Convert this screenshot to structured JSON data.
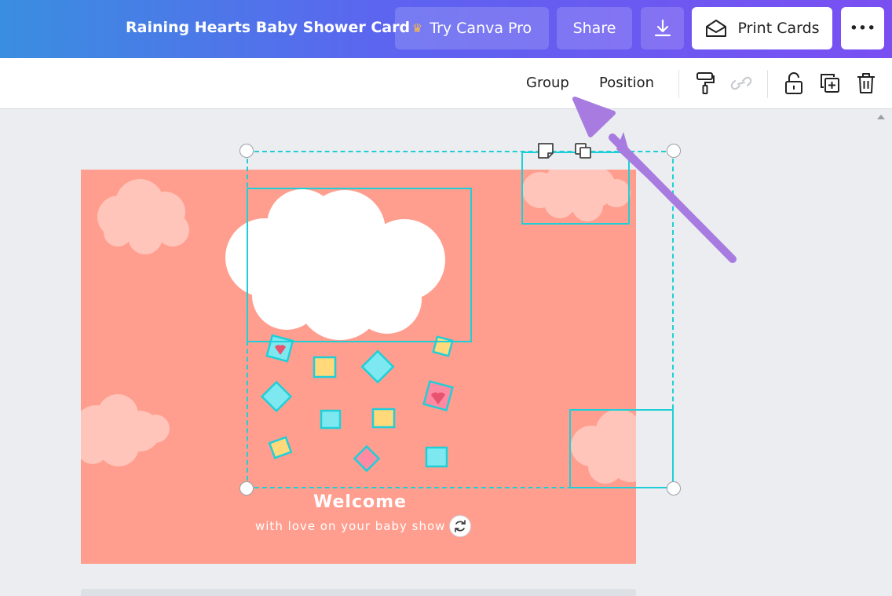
{
  "header": {
    "title": "Raining Hearts Baby Shower Card",
    "try_pro_label": "Try Canva Pro",
    "share_label": "Share",
    "print_label": "Print Cards",
    "more_label": "•••"
  },
  "toolbar": {
    "group_label": "Group",
    "position_label": "Position"
  },
  "card": {
    "welcome": "Welcome",
    "subline": "with love on your baby show"
  },
  "colors": {
    "accent": "#1fcfd8",
    "card_bg": "#ff9e8e",
    "pointer": "#a77be0"
  }
}
